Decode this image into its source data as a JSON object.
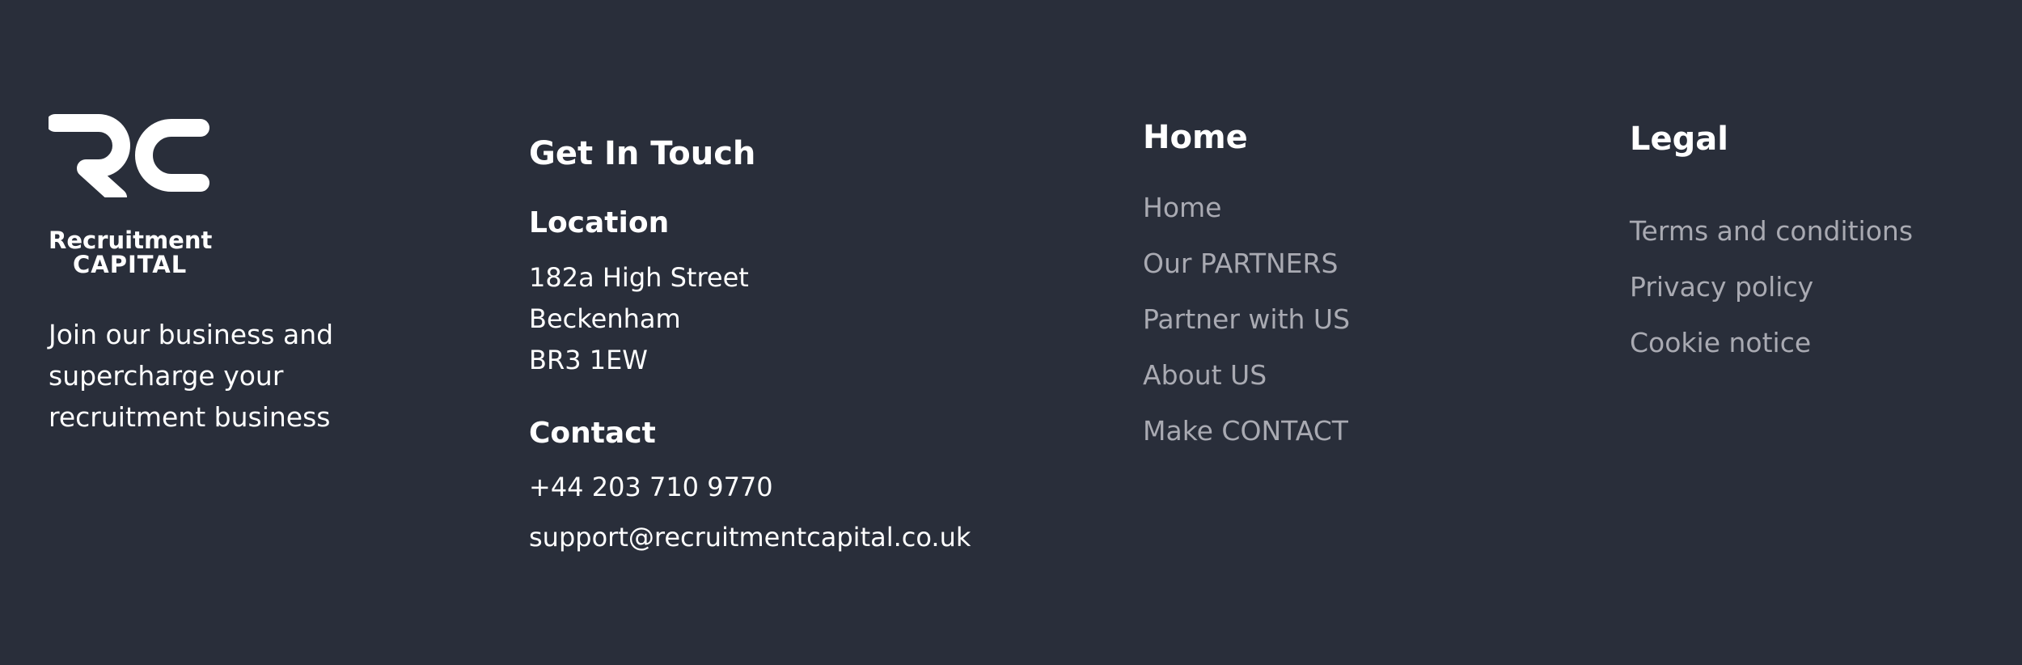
{
  "brand": {
    "logo_monogram": "RC",
    "wordmark_line1": "Recruitment",
    "wordmark_line2": "CAPITAL",
    "tagline_lines": [
      "Join our business and",
      "supercharge your",
      "recruitment business"
    ]
  },
  "contact": {
    "heading": "Get In Touch",
    "location_heading": "Location",
    "address": [
      "182a High Street",
      "Beckenham",
      "BR3 1EW"
    ],
    "contact_heading": "Contact",
    "phone": "+44 203 710 9770",
    "email": "support@recruitmentcapital.co.uk"
  },
  "nav_home": {
    "heading": "Home",
    "links": [
      "Home",
      "Our PARTNERS",
      "Partner with US",
      "About US",
      "Make CONTACT"
    ]
  },
  "nav_legal": {
    "heading": "Legal",
    "links": [
      "Terms and conditions",
      "Privacy policy",
      "Cookie notice"
    ]
  },
  "colors": {
    "background": "#292e3a",
    "primary_text": "#ffffff",
    "link_text": "#a9aab2"
  }
}
